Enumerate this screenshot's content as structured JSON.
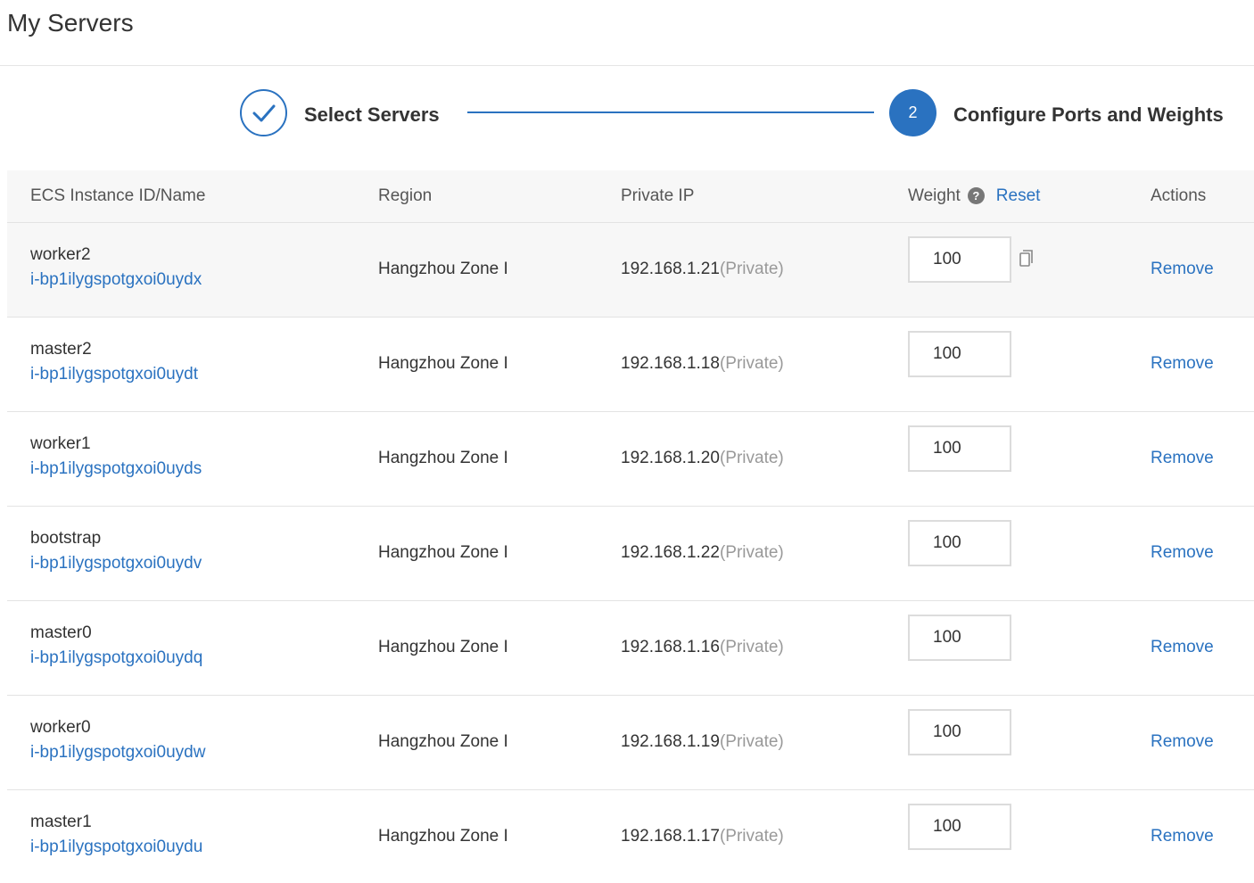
{
  "page": {
    "title": "My Servers"
  },
  "steps": [
    {
      "label": "Select Servers",
      "state": "done"
    },
    {
      "number": "2",
      "label": "Configure Ports and Weights",
      "state": "active"
    }
  ],
  "table": {
    "headers": {
      "id": "ECS Instance ID/Name",
      "region": "Region",
      "ip": "Private IP",
      "weight": "Weight",
      "reset": "Reset",
      "actions": "Actions"
    },
    "rows": [
      {
        "name": "worker2",
        "instance_id": "i-bp1ilygspotgxoi0uydx",
        "region": "Hangzhou Zone I",
        "ip": "192.168.1.21",
        "ip_type": "(Private)",
        "weight": "100",
        "action": "Remove"
      },
      {
        "name": "master2",
        "instance_id": "i-bp1ilygspotgxoi0uydt",
        "region": "Hangzhou Zone I",
        "ip": "192.168.1.18",
        "ip_type": "(Private)",
        "weight": "100",
        "action": "Remove"
      },
      {
        "name": "worker1",
        "instance_id": "i-bp1ilygspotgxoi0uyds",
        "region": "Hangzhou Zone I",
        "ip": "192.168.1.20",
        "ip_type": "(Private)",
        "weight": "100",
        "action": "Remove"
      },
      {
        "name": "bootstrap",
        "instance_id": "i-bp1ilygspotgxoi0uydv",
        "region": "Hangzhou Zone I",
        "ip": "192.168.1.22",
        "ip_type": "(Private)",
        "weight": "100",
        "action": "Remove"
      },
      {
        "name": "master0",
        "instance_id": "i-bp1ilygspotgxoi0uydq",
        "region": "Hangzhou Zone I",
        "ip": "192.168.1.16",
        "ip_type": "(Private)",
        "weight": "100",
        "action": "Remove"
      },
      {
        "name": "worker0",
        "instance_id": "i-bp1ilygspotgxoi0uydw",
        "region": "Hangzhou Zone I",
        "ip": "192.168.1.19",
        "ip_type": "(Private)",
        "weight": "100",
        "action": "Remove"
      },
      {
        "name": "master1",
        "instance_id": "i-bp1ilygspotgxoi0uydu",
        "region": "Hangzhou Zone I",
        "ip": "192.168.1.17",
        "ip_type": "(Private)",
        "weight": "100",
        "action": "Remove"
      }
    ]
  },
  "icons": {
    "step_done": "checkmark-icon",
    "help": "question-icon",
    "copy": "copy-icon"
  },
  "colors": {
    "accent": "#2a72c0",
    "muted": "#999999",
    "header_bg": "#f7f7f7"
  }
}
